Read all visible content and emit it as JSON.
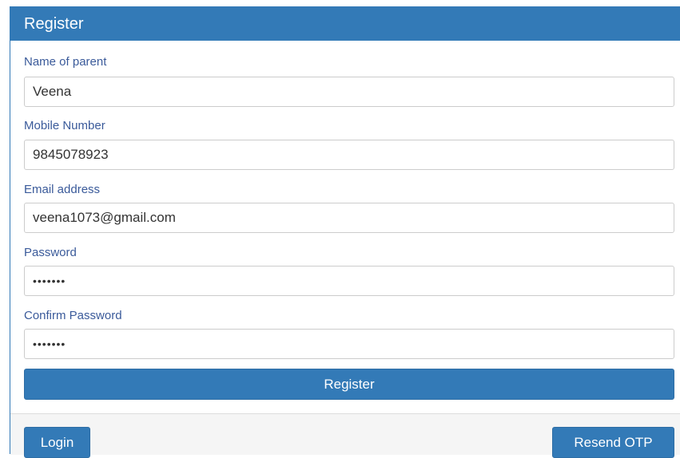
{
  "panel": {
    "title": "Register"
  },
  "form": {
    "parent_name": {
      "label": "Name of parent",
      "value": "Veena"
    },
    "mobile": {
      "label": "Mobile Number",
      "value": "9845078923"
    },
    "email": {
      "label": "Email address",
      "value": "veena1073@gmail.com"
    },
    "password": {
      "label": "Password",
      "value": "•••••••"
    },
    "confirm_password": {
      "label": "Confirm Password",
      "value": "•••••••"
    },
    "register_label": "Register"
  },
  "footer": {
    "login_label": "Login",
    "resend_otp_label": "Resend OTP"
  },
  "colors": {
    "primary": "#337ab7",
    "label": "#3a5a9a",
    "footer_bg": "#f5f5f5"
  }
}
